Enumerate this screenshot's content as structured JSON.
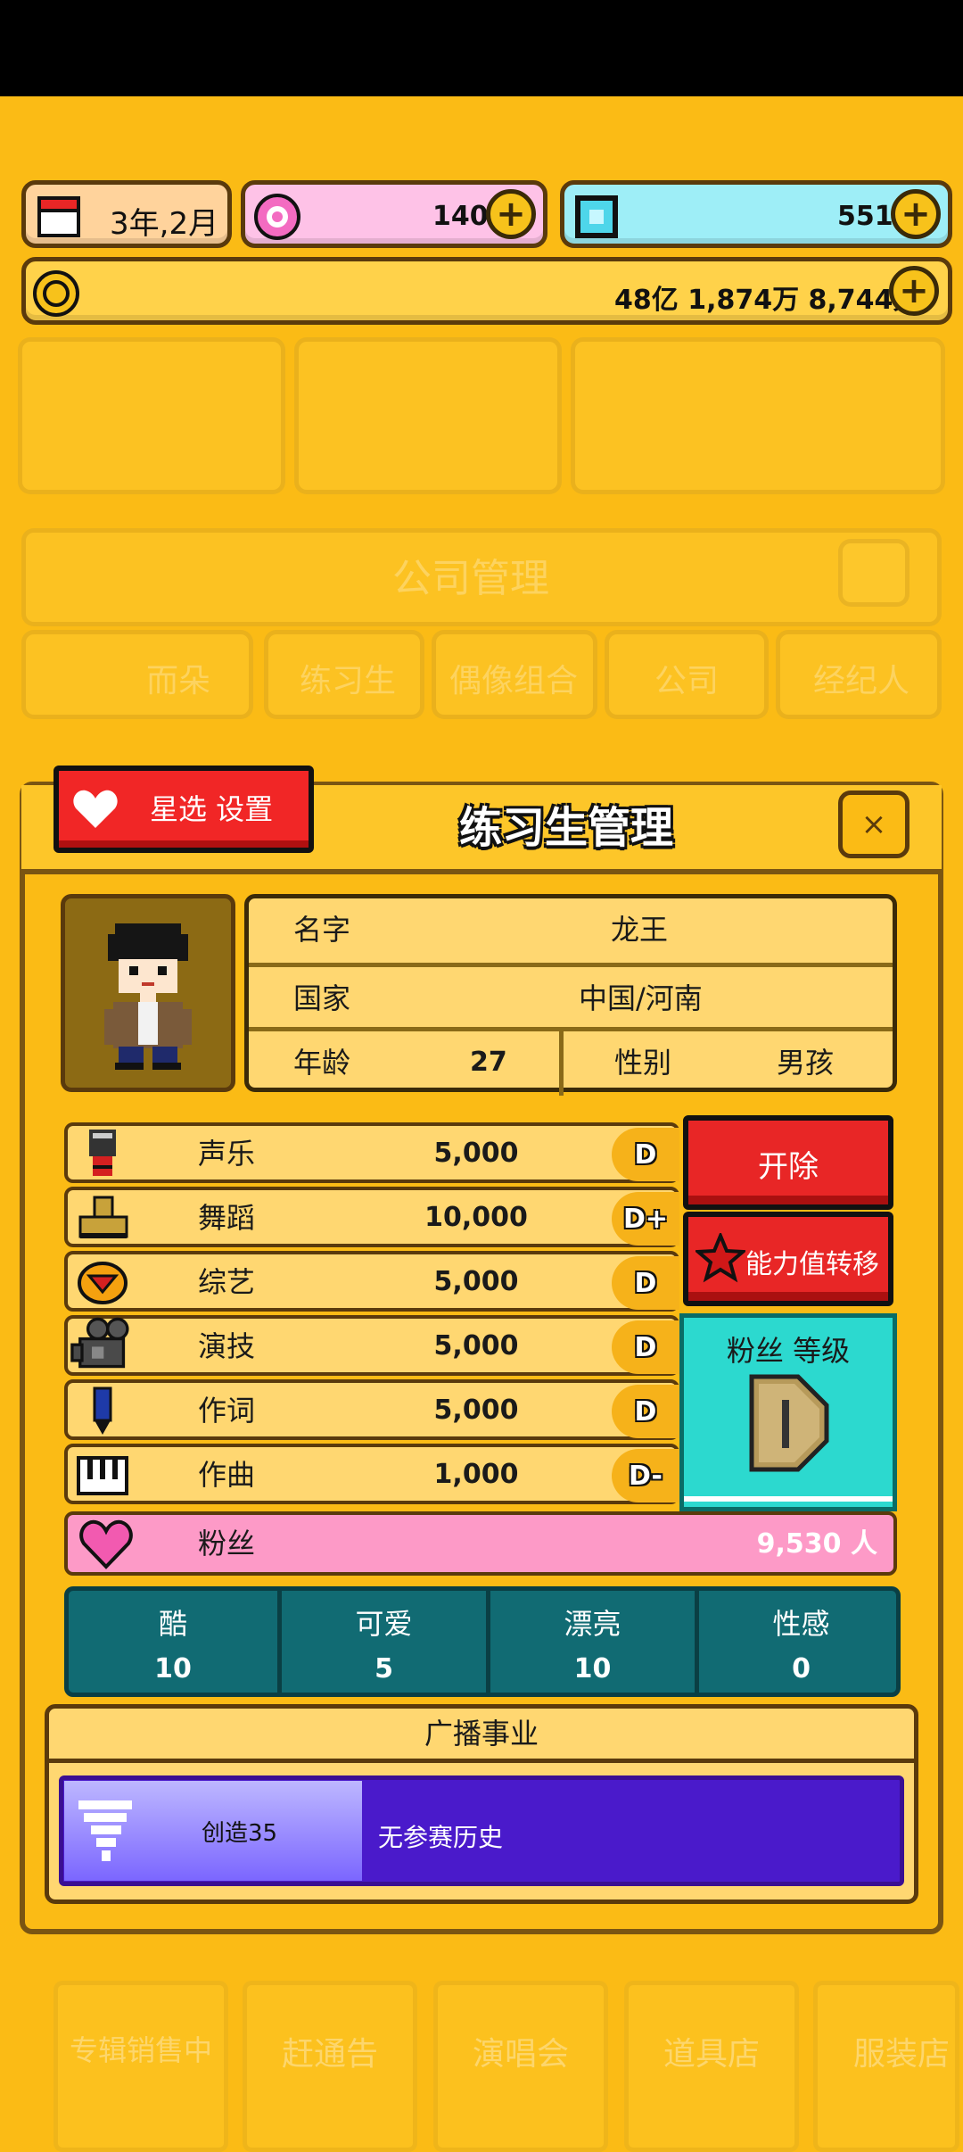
{
  "top": {
    "date": "3年,2月",
    "pink_currency": "140",
    "gem_currency": "551",
    "money": "48亿 1,874万 8,744元"
  },
  "background": {
    "panel_title": "公司管理",
    "tabs": [
      "而朵",
      "练习生",
      "偶像组合",
      "公司",
      "经纪人"
    ],
    "nav": [
      "专辑销售中",
      "赶通告",
      "演唱会",
      "道具店",
      "服装店"
    ]
  },
  "modal": {
    "title": "练习生管理",
    "star_button": "星选 设置",
    "close": "×"
  },
  "profile": {
    "name_label": "名字",
    "name_value": "龙王",
    "country_label": "国家",
    "country_value": "中国/河南",
    "age_label": "年龄",
    "age_value": "27",
    "gender_label": "性别",
    "gender_value": "男孩"
  },
  "stats": [
    {
      "name": "声乐",
      "value": "5,000",
      "grade": "D",
      "icon": "microphone-icon"
    },
    {
      "name": "舞蹈",
      "value": "10,000",
      "grade": "D+",
      "icon": "shoe-icon"
    },
    {
      "name": "综艺",
      "value": "5,000",
      "grade": "D",
      "icon": "bowl-icon"
    },
    {
      "name": "演技",
      "value": "5,000",
      "grade": "D",
      "icon": "camera-icon"
    },
    {
      "name": "作词",
      "value": "5,000",
      "grade": "D",
      "icon": "pen-icon"
    },
    {
      "name": "作曲",
      "value": "1,000",
      "grade": "D-",
      "icon": "piano-icon"
    }
  ],
  "fans": {
    "label": "粉丝",
    "value": "9,530 人"
  },
  "actions": {
    "fire": "开除",
    "transfer": "能力值转移",
    "fan_level": "粉丝 等级"
  },
  "attributes": [
    {
      "label": "酷",
      "value": "10"
    },
    {
      "label": "可爱",
      "value": "5"
    },
    {
      "label": "漂亮",
      "value": "10"
    },
    {
      "label": "性感",
      "value": "0"
    }
  ],
  "broadcast": {
    "title": "广播事业",
    "program": "创造35",
    "history": "无参赛历史"
  },
  "colors": {
    "background": "#FBBB15",
    "red_button": "#E82626",
    "fans_pink": "#FD9AC7",
    "attr_teal": "#116B73",
    "fan_level_cyan": "#2CD9CF",
    "program_purple": "#4A1ACB"
  }
}
